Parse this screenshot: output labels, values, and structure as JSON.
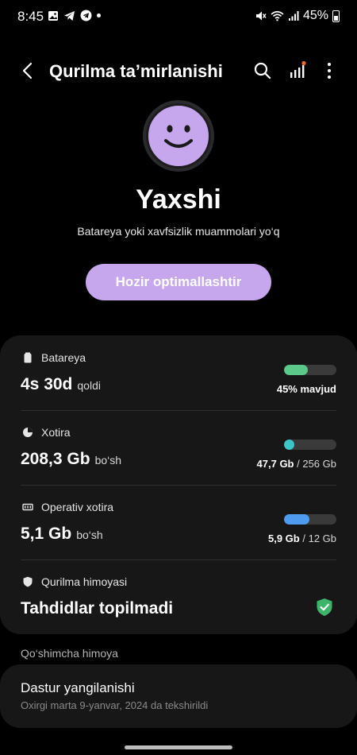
{
  "status_bar": {
    "time": "8:45",
    "battery_percent": "45%",
    "left_icons": [
      "image-icon",
      "telegram-icon",
      "telegram-alt-icon",
      "dot-icon"
    ],
    "right_icons": [
      "mute-icon",
      "wifi-icon",
      "cell-signal-icon",
      "battery-icon"
    ]
  },
  "header": {
    "title": "Qurilma ta’mirlanishi",
    "icons": [
      "back-icon",
      "search-icon",
      "signal-bars-icon",
      "more-icon"
    ]
  },
  "status": {
    "heading": "Yaxshi",
    "subtitle": "Batareya yoki xavfsizlik muammolari yo‘q",
    "face_color": "#c6a6ec"
  },
  "optimize_button": {
    "label": "Hozir optimallashtir",
    "color": "#c6a6ec"
  },
  "battery": {
    "label": "Batareya",
    "value": "4s 30d",
    "suffix": "qoldi",
    "caption": "45% mavjud",
    "fill_percent": 45,
    "fill_color": "#5cc88a"
  },
  "storage": {
    "label": "Xotira",
    "value": "208,3 Gb",
    "suffix": "bo‘sh",
    "used": "47,7 Gb",
    "total": "/ 256 Gb",
    "fill_percent": 19,
    "fill_color": "#3ec5c8"
  },
  "ram": {
    "label": "Operativ xotira",
    "value": "5,1 Gb",
    "suffix": "bo‘sh",
    "used": "5,9 Gb",
    "total": "/ 12 Gb",
    "fill_percent": 49,
    "fill_color": "#4f9bf0"
  },
  "protection": {
    "label": "Qurilma himoyasi",
    "value": "Tahdidlar topilmadi",
    "check_color": "#3cb56a"
  },
  "additional": {
    "section_title": "Qo‘shimcha himoya",
    "update_title": "Dastur yangilanishi",
    "update_subtitle": "Oxirgi marta 9-yanvar, 2024 da tekshirildi"
  }
}
